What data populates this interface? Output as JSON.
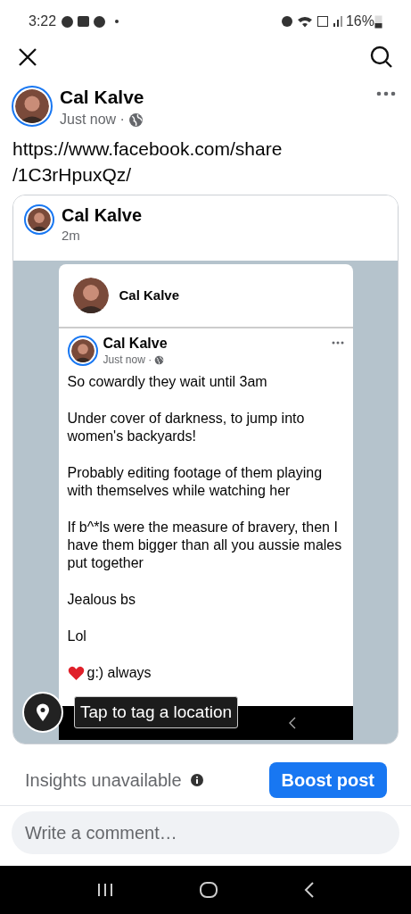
{
  "status_bar": {
    "time": "3:22",
    "battery": "16%"
  },
  "post": {
    "author": "Cal Kalve",
    "time": "Just now ·",
    "text": "https://www.facebook.com/share\n/1C3rHpuxQz/"
  },
  "link_preview": {
    "author": "Cal Kalve",
    "time": "2m",
    "screenshot": {
      "profile_name": "Cal Kalve",
      "post_author": "Cal Kalve",
      "post_time": "Just now ·",
      "paragraphs": [
        {
          "kind": "text",
          "text": "So cowardly they wait until 3am"
        },
        {
          "kind": "text",
          "text": "Under cover of darkness, to jump into women's backyards!"
        },
        {
          "kind": "text",
          "text": "Probably editing footage of them playing with themselves while watching her"
        },
        {
          "kind": "text",
          "text": "If b^*ls were the measure of bravery, then I have them bigger than all you aussie males put together"
        },
        {
          "kind": "text",
          "text": "Jealous bs"
        },
        {
          "kind": "text",
          "text": "Lol"
        },
        {
          "kind": "heart",
          "text": "g:) always"
        }
      ]
    },
    "tooltip": "Tap to tag a location"
  },
  "footer": {
    "insights": "Insights unavailable",
    "boost_button": "Boost post"
  },
  "comment": {
    "placeholder": "Write a comment…"
  }
}
